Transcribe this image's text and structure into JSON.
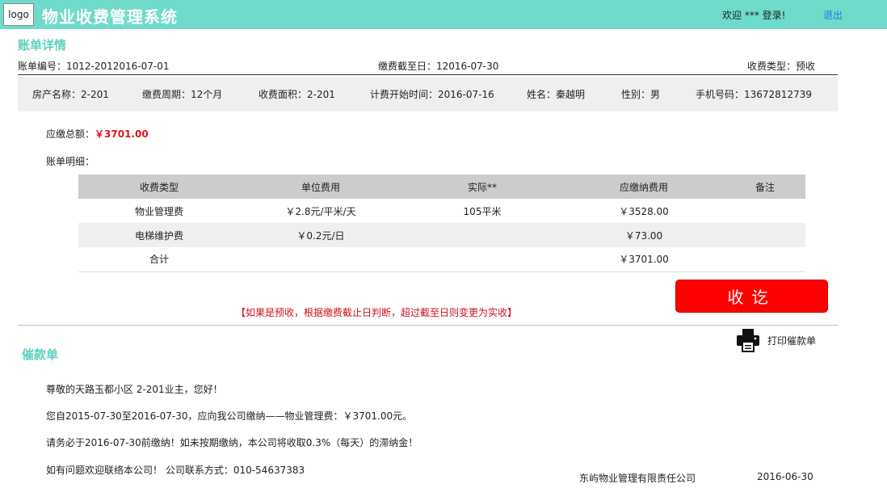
{
  "header": {
    "logo": "logo",
    "title": "物业收费管理系统",
    "welcome": "欢迎 ***  登录!",
    "logout": "退出"
  },
  "bill": {
    "section_title": "账单详情",
    "bill_no": "账单编号：1012-2012016-07-01",
    "due_to": "缴费截至日：12016-07-30",
    "charge_type": "收费类型：预收",
    "property": {
      "name": "房产名称：2-201",
      "period": "缴费周期：12个月",
      "area": "收费面积：2-201",
      "start": "计费开始时间：2016-07-16",
      "owner": "姓名：秦越明",
      "gender": "性别：男",
      "phone": "手机号码：13672812739"
    },
    "total_label": "应缴总额：",
    "total_value": "￥3701.00",
    "detail_label": "账单明细：",
    "table": {
      "headers": [
        "收费类型",
        "单位费用",
        "实际**",
        "应缴纳费用",
        "备注"
      ],
      "rows": [
        [
          "物业管理费",
          "￥2.8元/平米/天",
          "105平米",
          "￥3528.00",
          ""
        ],
        [
          "电梯维护费",
          "￥0.2元/日",
          "",
          "￥73.00",
          ""
        ]
      ],
      "sum_label": "合计",
      "sum_value": "￥3701.00"
    },
    "collect_button": "收讫",
    "note": "【如果是预收，根据缴费截止日判断，超过截至日则变更为实收】"
  },
  "reminder": {
    "section_title": "催款单",
    "print_label": "打印催款单",
    "print_icon": "printer-icon",
    "line1": "尊敬的天路玉都小区 2-201业主，您好！",
    "line2": "您自2015-07-30至2016-07-30，应向我公司缴纳——物业管理费：￥3701.00元。",
    "line3": "请务必于2016-07-30前缴纳！如未按期缴纳，本公司将收取0.3%（每天）的滞纳金！",
    "line4": "如有问题欢迎联络本公司！ 公司联系方式：010-54637383",
    "company": "东屿物业管理有限责任公司",
    "date": "2016-06-30"
  },
  "colors": {
    "topbar": "#6fdbcb",
    "section": "#5fcfc0",
    "accent_red": "#e0141e",
    "button_red": "#ff0000",
    "link_blue": "#1a7fd6"
  }
}
